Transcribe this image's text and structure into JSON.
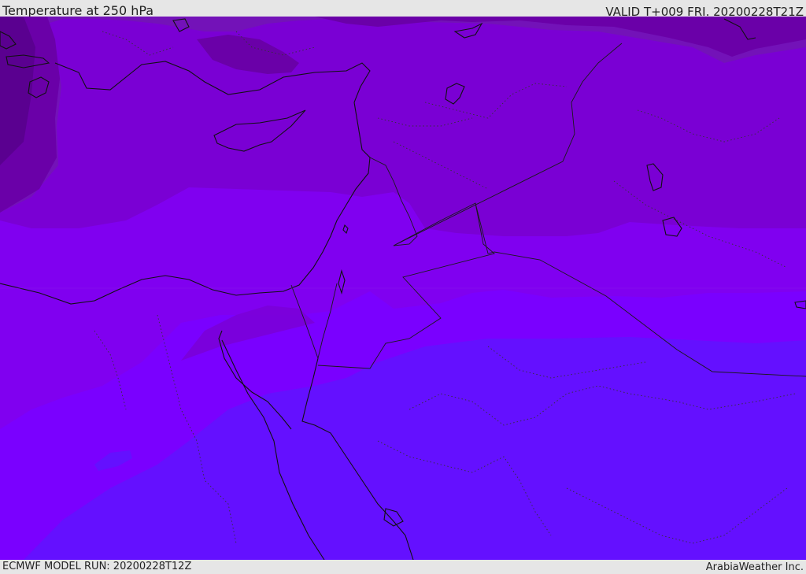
{
  "header": {
    "title": "Temperature at 250 hPa",
    "valid": "VALID T+009 FRI. 20200228T21Z"
  },
  "footer": {
    "model_run": "ECMWF MODEL RUN: 20200228T12Z",
    "credit": "ArabiaWeather Inc."
  },
  "colors": {
    "band_darkest": "#5a0090",
    "band_dark": "#6a00a8",
    "band_mid_dark": "#7312b8",
    "band_mid": "#7a00d4",
    "band_bright": "#8000f0",
    "band_light": "#7a00ff",
    "band_blue": "#6410ff",
    "coastline": "#111111",
    "border_dotted": "#333333"
  }
}
